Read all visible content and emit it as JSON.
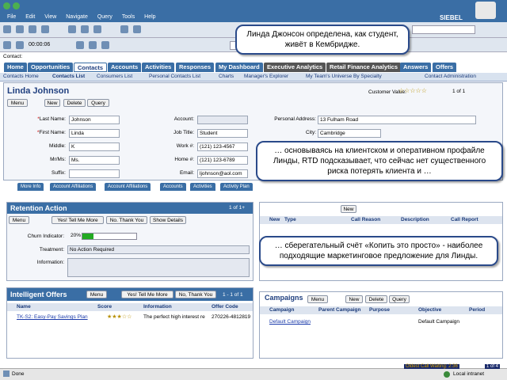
{
  "menu": {
    "file": "File",
    "edit": "Edit",
    "view": "View",
    "navigate": "Navigate",
    "query": "Query",
    "tools": "Tools",
    "help": "Help"
  },
  "brand": "SIEBEL",
  "timer": "00:00:06",
  "context_label": "Contact:",
  "tabs": [
    "Home",
    "Opportunities",
    "Contacts",
    "Accounts",
    "Activities",
    "Responses",
    "My Dashboard",
    "Executive Analytics",
    "Retail Finance Analytics",
    "Answers",
    "Offers"
  ],
  "subnav": [
    "Contacts Home",
    "Contacts List",
    "Consumers List",
    "Personal Contacts List",
    "Charts",
    "Manager's Explorer",
    "My Team's Universe By Specialty",
    "Contact Administration"
  ],
  "contact": {
    "title": "Linda Johnson",
    "menu": "Menu",
    "new": "New",
    "delete": "Delete",
    "query": "Query",
    "customer_value_label": "Customer Value:",
    "record_count": "1 of 1",
    "last_name_label": "Last Name:",
    "last_name": "Johnson",
    "first_name_label": "First Name:",
    "first_name": "Linda",
    "middle_label": "Middle:",
    "middle": "K",
    "mrms_label": "Mr/Ms:",
    "mrms": "Ms.",
    "suffix_label": "Suffix:",
    "account_label": "Account:",
    "job_title_label": "Job Title:",
    "job_title": "Student",
    "work_label": "Work #:",
    "work": "(121) 123-4567",
    "home_label": "Home #:",
    "home": "(121) 123-6789",
    "email_label": "Email:",
    "email": "ljohnson@aol.com",
    "address_label": "Personal Address:",
    "address": "13 Fulham Road",
    "city_label": "City:",
    "city": "Cambridge"
  },
  "view_tabs": [
    "More Info",
    "Account Affiliations",
    "Account Affiliations",
    "Accounts",
    "Activities",
    "Activity Plan"
  ],
  "retention": {
    "title": "Retention Action",
    "count": "1 of 1+",
    "menu": "Menu",
    "yes": "Yes! Tell Me More",
    "no": "No. Thank You",
    "details": "Show Details",
    "churn_label": "Churn Indicator:",
    "churn": "20%",
    "churn_fraction": 0.2,
    "treatment_label": "Treatment:",
    "treatment": "No Action Required",
    "info_label": "Information:"
  },
  "right_list": {
    "new": "New",
    "columns": [
      "New",
      "Type",
      "Call Reason",
      "Description",
      "Call Report"
    ]
  },
  "offers": {
    "title": "Intelligent Offers",
    "menu": "Menu",
    "yes": "Yes! Tell Me More",
    "no": "No, Thank You",
    "count": "1 - 1 of 1",
    "columns": [
      "Name",
      "Score",
      "Information",
      "Offer Code"
    ],
    "row": {
      "name": "TK-S2: Easy-Pay Savings Plan",
      "info": "The perfect high interest re",
      "code": "270226-4812819"
    }
  },
  "campaigns": {
    "title": "Campaigns",
    "menu": "Menu",
    "new": "New",
    "delete": "Delete",
    "query": "Query",
    "columns": [
      "Campaign",
      "Parent Campaign",
      "Purpose",
      "Objective",
      "Period"
    ],
    "row": {
      "name": "Default Campaign",
      "objective": "Default Campaign"
    }
  },
  "callouts": {
    "c1": "Линда Джонсон определена, как студент, живёт в Кембридже.",
    "c2": "… основываясь на клиентском и оперативном профайле Линды, RTD подсказывает, что сейчас нет существенного риска потерять клиента и …",
    "c3": "… сберегательный счёт «Копить это просто» - наиболее подходящие маркетинговое предложение для Линды."
  },
  "status": {
    "done": "Done",
    "call_waiting": "Oldest Call Waiting: 2:36",
    "pages": "1 of 4",
    "zone": "Local intranet"
  },
  "colors": {
    "accent": "#3a6ea5",
    "callout_border": "#2a4a8a",
    "churn_bar": "#22aa22"
  }
}
